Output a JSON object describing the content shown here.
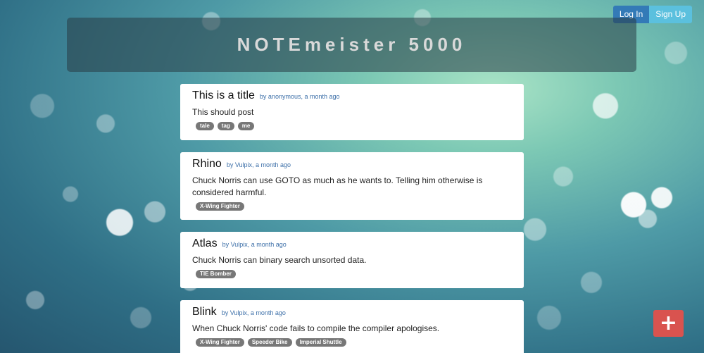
{
  "auth": {
    "login_label": "Log In",
    "signup_label": "Sign Up"
  },
  "banner": {
    "title": "NOTEmeister 5000"
  },
  "notes": [
    {
      "title": "This is a title",
      "meta": "by anonymous, a month ago",
      "body": "This should post",
      "tags": [
        "tale",
        "tag",
        "me"
      ]
    },
    {
      "title": "Rhino",
      "meta": "by Vulpix, a month ago",
      "body": "Chuck Norris can use GOTO as much as he wants to. Telling him otherwise is considered harmful.",
      "tags": [
        "X-Wing Fighter"
      ]
    },
    {
      "title": "Atlas",
      "meta": "by Vulpix, a month ago",
      "body": "Chuck Norris can binary search unsorted data.",
      "tags": [
        "TIE Bomber"
      ]
    },
    {
      "title": "Blink",
      "meta": "by Vulpix, a month ago",
      "body": "When Chuck Norris' code fails to compile the compiler apologises.",
      "tags": [
        "X-Wing Fighter",
        "Speeder Bike",
        "Imperial Shuttle"
      ]
    }
  ],
  "fab": {
    "icon": "plus-icon",
    "symbol": "+"
  },
  "colors": {
    "login": "#337ab7",
    "signup": "#5bc0de",
    "fab": "#d9534f",
    "tag": "#777777",
    "meta_link": "#3c6fa8"
  }
}
